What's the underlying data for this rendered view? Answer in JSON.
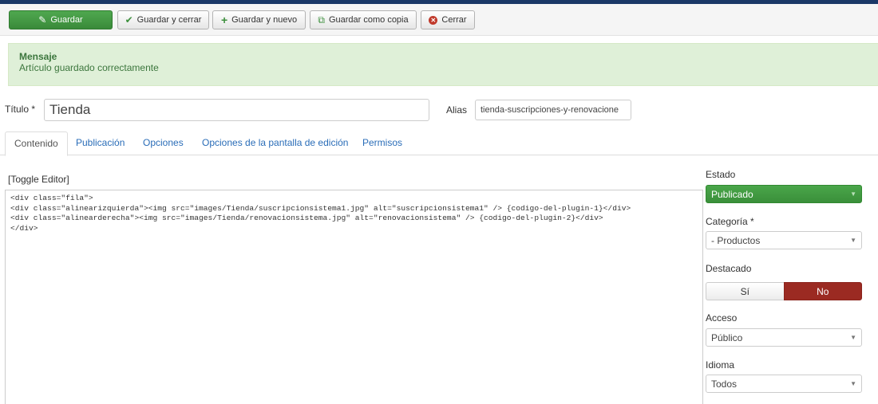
{
  "toolbar": {
    "save": "Guardar",
    "save_close": "Guardar y cerrar",
    "save_new": "Guardar y nuevo",
    "save_copy": "Guardar como copia",
    "close": "Cerrar"
  },
  "message": {
    "heading": "Mensaje",
    "text": "Artículo guardado correctamente"
  },
  "form": {
    "title_label": "Título *",
    "title_value": "Tienda",
    "alias_label": "Alias",
    "alias_value": "tienda-suscripciones-y-renovacione"
  },
  "tabs": [
    "Contenido",
    "Publicación",
    "Opciones",
    "Opciones de la pantalla de edición",
    "Permisos"
  ],
  "editor": {
    "toggle": "[Toggle Editor]",
    "lines": [
      "<div class=\"fila\">",
      "<div class=\"alinearizquierda\"><img src=\"images/Tienda/suscripcionsistema1.jpg\" alt=\"suscripcionsistema1\" /> {codigo-del-plugin-1}</div>",
      "<div class=\"alinearderecha\"><img src=\"images/Tienda/renovacionsistema.jpg\" alt=\"renovacionsistema\" /> {codigo-del-plugin-2}</div>",
      "</div>"
    ]
  },
  "sidebar": {
    "estado_label": "Estado",
    "estado_value": "Publicado",
    "categoria_label": "Categoría *",
    "categoria_value": "- Productos",
    "destacado_label": "Destacado",
    "destacado_yes": "Sí",
    "destacado_no": "No",
    "acceso_label": "Acceso",
    "acceso_value": "Público",
    "idioma_label": "Idioma",
    "idioma_value": "Todos"
  },
  "colors": {
    "primary": "#3c8f3c",
    "message_bg": "#dff0d8",
    "danger": "#9b2a22",
    "link": "#2a6db8"
  }
}
